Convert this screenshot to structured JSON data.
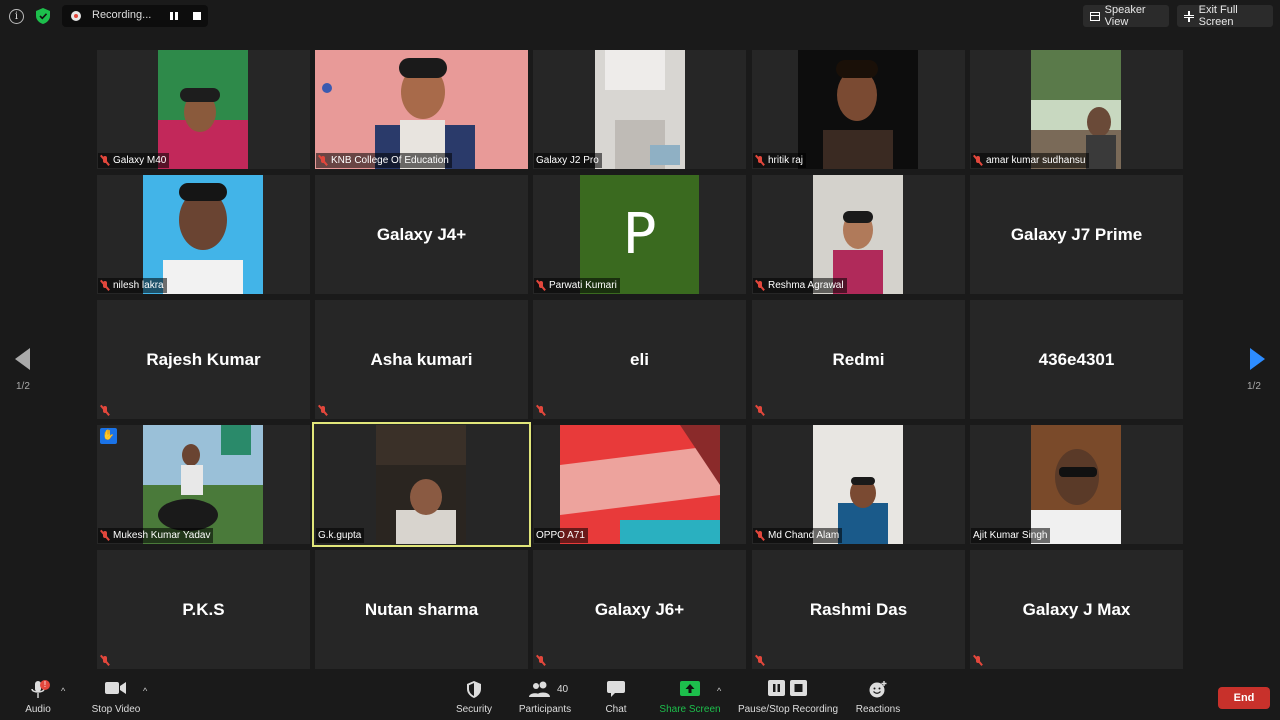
{
  "topbar": {
    "recording_text": "Recording...",
    "speaker_view": "Speaker View",
    "exit_full_screen": "Exit Full Screen"
  },
  "tiles": [
    {
      "type": "video",
      "label": "Galaxy M40"
    },
    {
      "type": "video",
      "label": "KNB College Of Education"
    },
    {
      "type": "video",
      "label": "Galaxy J2 Pro"
    },
    {
      "type": "video",
      "label": "hritik raj"
    },
    {
      "type": "video",
      "label": "amar kumar sudhansu"
    },
    {
      "type": "video",
      "label": "nilesh lakra"
    },
    {
      "type": "name",
      "label": "Galaxy J4+"
    },
    {
      "type": "avatar",
      "label": "Parwati Kumari",
      "initial": "P"
    },
    {
      "type": "video",
      "label": "Reshma Agrawal"
    },
    {
      "type": "name",
      "label": "Galaxy J7 Prime"
    },
    {
      "type": "name",
      "label": "Rajesh Kumar"
    },
    {
      "type": "name",
      "label": "Asha kumari"
    },
    {
      "type": "name",
      "label": "eli"
    },
    {
      "type": "name",
      "label": "Redmi"
    },
    {
      "type": "name",
      "label": "436e4301"
    },
    {
      "type": "video",
      "label": "Mukesh Kumar Yadav"
    },
    {
      "type": "video",
      "label": "G.k.gupta"
    },
    {
      "type": "video",
      "label": "OPPO A71"
    },
    {
      "type": "video",
      "label": "Md Chand Alam"
    },
    {
      "type": "video",
      "label": "Ajit Kumar Singh"
    },
    {
      "type": "name",
      "label": "P.K.S"
    },
    {
      "type": "name",
      "label": "Nutan sharma"
    },
    {
      "type": "name",
      "label": "Galaxy J6+"
    },
    {
      "type": "name",
      "label": "Rashmi Das"
    },
    {
      "type": "name",
      "label": "Galaxy J Max"
    }
  ],
  "pager": {
    "left": "1/2",
    "right": "1/2"
  },
  "toolbar": {
    "audio": "Audio",
    "audio_badge": "!",
    "stop_video": "Stop Video",
    "security": "Security",
    "participants": "Participants",
    "participants_count": "40",
    "chat": "Chat",
    "share_screen": "Share Screen",
    "recording": "Pause/Stop Recording",
    "reactions": "Reactions",
    "end": "End"
  },
  "colors": {
    "accent": "#2d8cff",
    "share": "#1dbf4c",
    "end": "#c8312b",
    "active_speaker": "#e1e67a",
    "mute": "#e2473c"
  }
}
